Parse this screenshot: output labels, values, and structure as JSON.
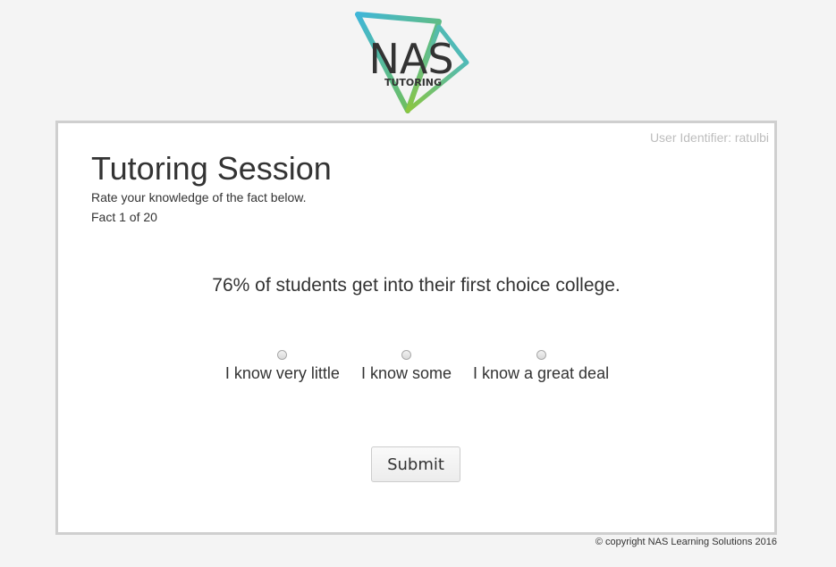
{
  "brand": {
    "logo_text": "NAS",
    "logo_subtext": "TUTORING",
    "colors": {
      "teal": "#3fb6d8",
      "green": "#7ac142",
      "dark": "#333333"
    }
  },
  "session": {
    "user_identifier": "User Identifier: ratulbi",
    "title": "Tutoring Session",
    "instruction": "Rate your knowledge of the fact below.",
    "progress": "Fact 1 of 20"
  },
  "fact": {
    "text": "76% of students get into their first choice college."
  },
  "rating": {
    "options": [
      {
        "label": "I know very little",
        "selected": false
      },
      {
        "label": "I know some",
        "selected": false
      },
      {
        "label": "I know a great deal",
        "selected": false
      }
    ]
  },
  "actions": {
    "submit_label": "Submit"
  },
  "footer": {
    "copyright": "© copyright NAS Learning Solutions 2016"
  }
}
